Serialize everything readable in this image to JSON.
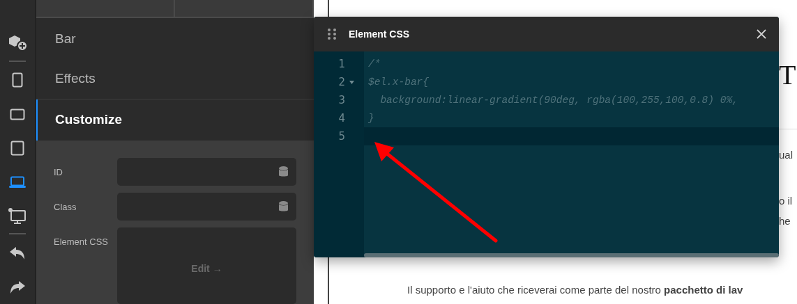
{
  "toolbar": {
    "items": [
      {
        "kind": "add",
        "selected": false
      },
      {
        "kind": "divider"
      },
      {
        "kind": "phone",
        "selected": false
      },
      {
        "kind": "wide",
        "selected": false
      },
      {
        "kind": "tablet",
        "selected": false
      },
      {
        "kind": "laptop",
        "selected": true
      },
      {
        "kind": "desktop",
        "selected": false
      },
      {
        "kind": "divider"
      },
      {
        "kind": "undo",
        "selected": false
      },
      {
        "kind": "redo",
        "selected": false
      }
    ]
  },
  "panel": {
    "sections": [
      {
        "label": "Bar",
        "selected": false
      },
      {
        "label": "Effects",
        "selected": false
      },
      {
        "label": "Customize",
        "selected": true
      }
    ],
    "fields": [
      {
        "label": "ID",
        "kind": "input"
      },
      {
        "label": "Class",
        "kind": "input"
      },
      {
        "label": "Element CSS",
        "kind": "editor",
        "button": "Edit →"
      }
    ]
  },
  "page": {
    "heading": "T",
    "fragments": [
      "ual",
      "o il",
      "he"
    ],
    "sentence": "Il supporto e l'aiuto che riceverai come parte del nostro **pacchetto di lav**"
  },
  "dialog": {
    "title": "Element CSS",
    "lines": [
      {
        "number": "1",
        "text": "/*",
        "foldable": false,
        "selected": false
      },
      {
        "number": "2",
        "text": "$el.x-bar{",
        "foldable": true,
        "selected": false
      },
      {
        "number": "3",
        "text": "  background:linear-gradient(90deg, rgba(100,255,100,0.8) 0%,",
        "foldable": false,
        "selected": false
      },
      {
        "number": "4",
        "text": "}",
        "foldable": false,
        "selected": false
      },
      {
        "number": "5",
        "foldable": false,
        "selected": true
      }
    ]
  }
}
